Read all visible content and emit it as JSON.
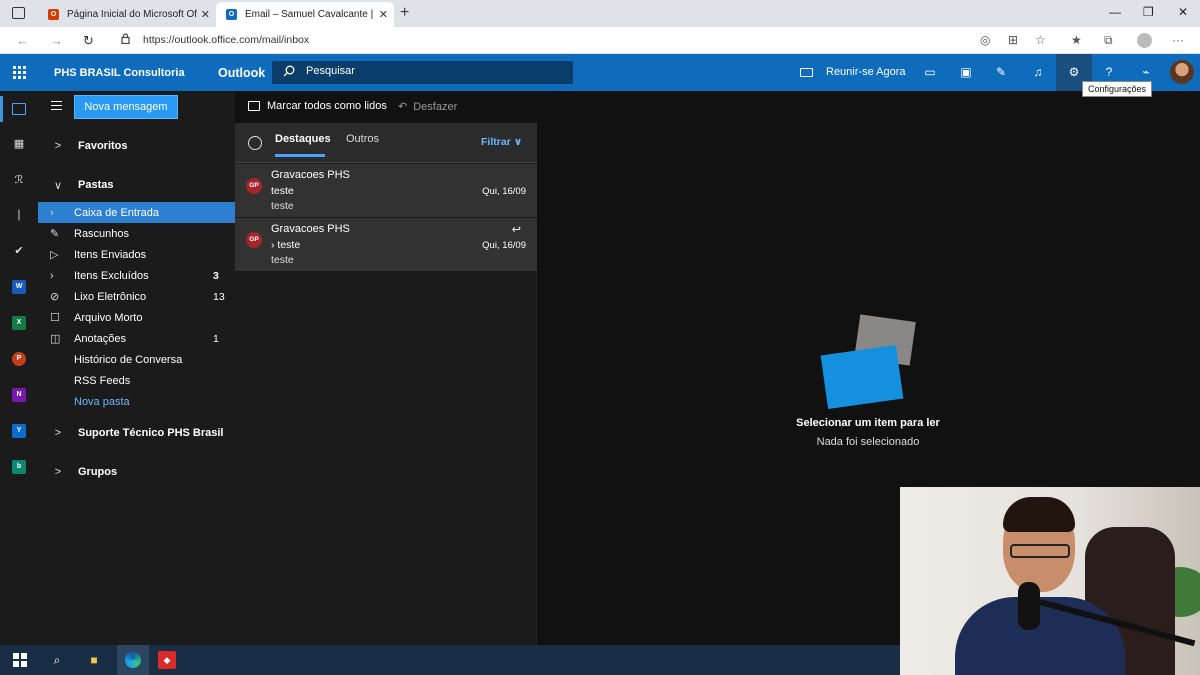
{
  "browser": {
    "tabs": [
      {
        "label": "Página Inicial do Microsoft Office",
        "icon": "office-icon"
      },
      {
        "label": "Email – Samuel Cavalcante | PHS",
        "icon": "outlook-icon"
      }
    ],
    "url": "https://outlook.office.com/mail/inbox"
  },
  "header": {
    "org": "PHS BRASIL Consultoria",
    "app": "Outlook",
    "search_placeholder": "Pesquisar",
    "meet_label": "Reunir-se Agora",
    "tooltip": "Configurações",
    "accent": "#0f6cbd"
  },
  "folders": {
    "new_message": "Nova mensagem",
    "favorites": "Favoritos",
    "pastas": "Pastas",
    "items": [
      {
        "name": "Caixa de Entrada",
        "count": "",
        "icon": "chevron-right-icon"
      },
      {
        "name": "Rascunhos",
        "count": "",
        "icon": "pencil-icon"
      },
      {
        "name": "Itens Enviados",
        "count": "",
        "icon": "send-icon"
      },
      {
        "name": "Itens Excluídos",
        "count": "3",
        "icon": "chevron-right-icon"
      },
      {
        "name": "Lixo Eletrônico",
        "count": "13",
        "icon": "block-icon"
      },
      {
        "name": "Arquivo Morto",
        "count": "",
        "icon": "archive-icon"
      },
      {
        "name": "Anotações",
        "count": "1",
        "icon": "note-icon"
      },
      {
        "name": "Histórico de Conversa",
        "count": "",
        "icon": ""
      },
      {
        "name": "RSS Feeds",
        "count": "",
        "icon": ""
      },
      {
        "name": "Nova pasta",
        "count": "",
        "icon": ""
      }
    ],
    "support": "Suporte Técnico PHS Brasil",
    "groups": "Grupos"
  },
  "commands": {
    "mark_all": "Marcar todos como lidos",
    "undo": "Desfazer"
  },
  "list": {
    "tab_focused": "Destaques",
    "tab_other": "Outros",
    "filter": "Filtrar",
    "messages": [
      {
        "initials": "GP",
        "sender": "Gravacoes PHS",
        "subject": "teste",
        "preview": "teste",
        "date": "Qui, 16/09"
      },
      {
        "initials": "GP",
        "sender": "Gravacoes PHS",
        "subject": "teste",
        "preview": "teste",
        "date": "Qui, 16/09"
      }
    ]
  },
  "reading": {
    "title": "Selecionar um item para ler",
    "subtitle": "Nada foi selecionado"
  }
}
